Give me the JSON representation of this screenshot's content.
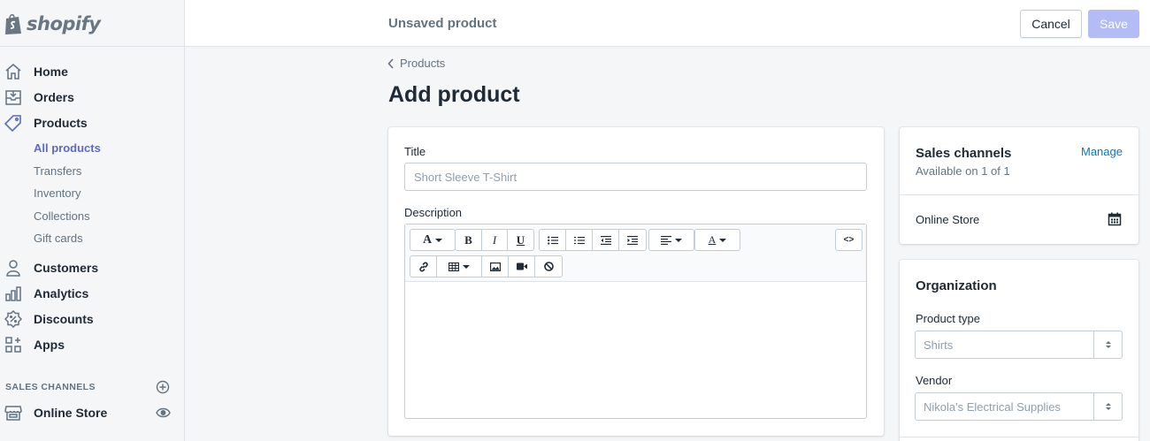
{
  "brand": {
    "name": "shopify"
  },
  "sidebar": {
    "nav": [
      {
        "label": "Home",
        "icon": "home-icon"
      },
      {
        "label": "Orders",
        "icon": "orders-icon"
      },
      {
        "label": "Products",
        "icon": "tag-icon"
      }
    ],
    "products_sub": [
      {
        "label": "All products",
        "active": true
      },
      {
        "label": "Transfers"
      },
      {
        "label": "Inventory"
      },
      {
        "label": "Collections"
      },
      {
        "label": "Gift cards"
      }
    ],
    "nav2": [
      {
        "label": "Customers",
        "icon": "person-icon"
      },
      {
        "label": "Analytics",
        "icon": "bar-chart-icon"
      },
      {
        "label": "Discounts",
        "icon": "discount-icon"
      },
      {
        "label": "Apps",
        "icon": "apps-icon"
      }
    ],
    "sales_channels_heading": "SALES CHANNELS",
    "online_store": "Online Store"
  },
  "topbar": {
    "title": "Unsaved product",
    "cancel_label": "Cancel",
    "save_label": "Save"
  },
  "main": {
    "breadcrumb": "Products",
    "page_title": "Add product",
    "title_label": "Title",
    "title_placeholder": "Short Sleeve T-Shirt",
    "description_label": "Description",
    "toolbar": {
      "font_glyph": "A",
      "bold_glyph": "B",
      "italic_glyph": "I",
      "underline_glyph": "U",
      "color_glyph": "A",
      "html_glyph": "<>"
    }
  },
  "sales_channels": {
    "title": "Sales channels",
    "subtitle": "Available on 1 of 1",
    "manage_label": "Manage",
    "store": "Online Store"
  },
  "organization": {
    "title": "Organization",
    "product_type_label": "Product type",
    "product_type_value": "Shirts",
    "vendor_label": "Vendor",
    "vendor_value": "Nikola's Electrical Supplies"
  },
  "colors": {
    "accent": "#5c6ac4",
    "link": "#007ace",
    "save_disabled": "#b3bcf5",
    "background": "#f4f6f8"
  }
}
